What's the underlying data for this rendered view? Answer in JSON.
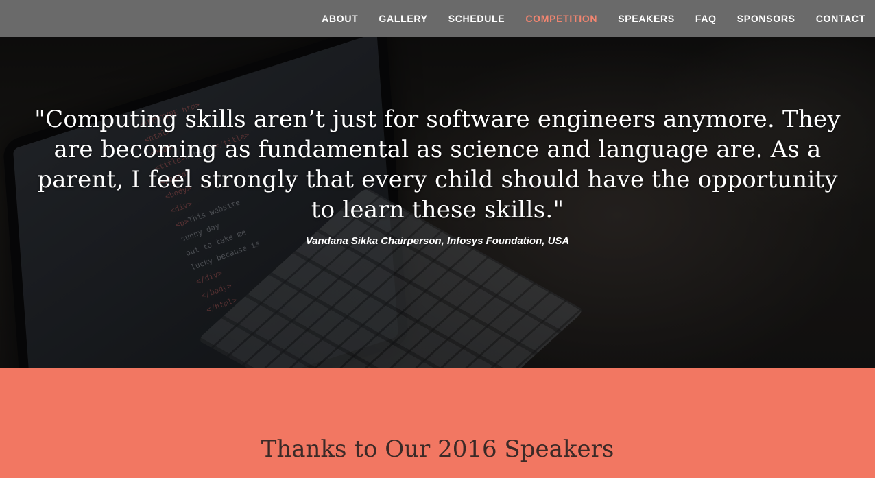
{
  "nav": {
    "items": [
      {
        "label": "ABOUT"
      },
      {
        "label": "GALLERY"
      },
      {
        "label": "SCHEDULE"
      },
      {
        "label": "COMPETITION"
      },
      {
        "label": "SPEAKERS"
      },
      {
        "label": "FAQ"
      },
      {
        "label": "SPONSORS"
      },
      {
        "label": "CONTACT"
      }
    ],
    "active_label": "COMPETITION",
    "active_color": "#f28570"
  },
  "hero": {
    "quote": "\"Computing skills aren’t just for software engineers anymore. They are becoming as fundamental as science and language are. As a parent, I feel strongly that every child should have the opportunity to learn these skills.\"",
    "attribution": "Vandana Sikka Chairperson, Infosys Foundation, USA"
  },
  "speakers_section": {
    "title": "Thanks to Our 2016 Speakers",
    "background_color": "#f27762"
  }
}
